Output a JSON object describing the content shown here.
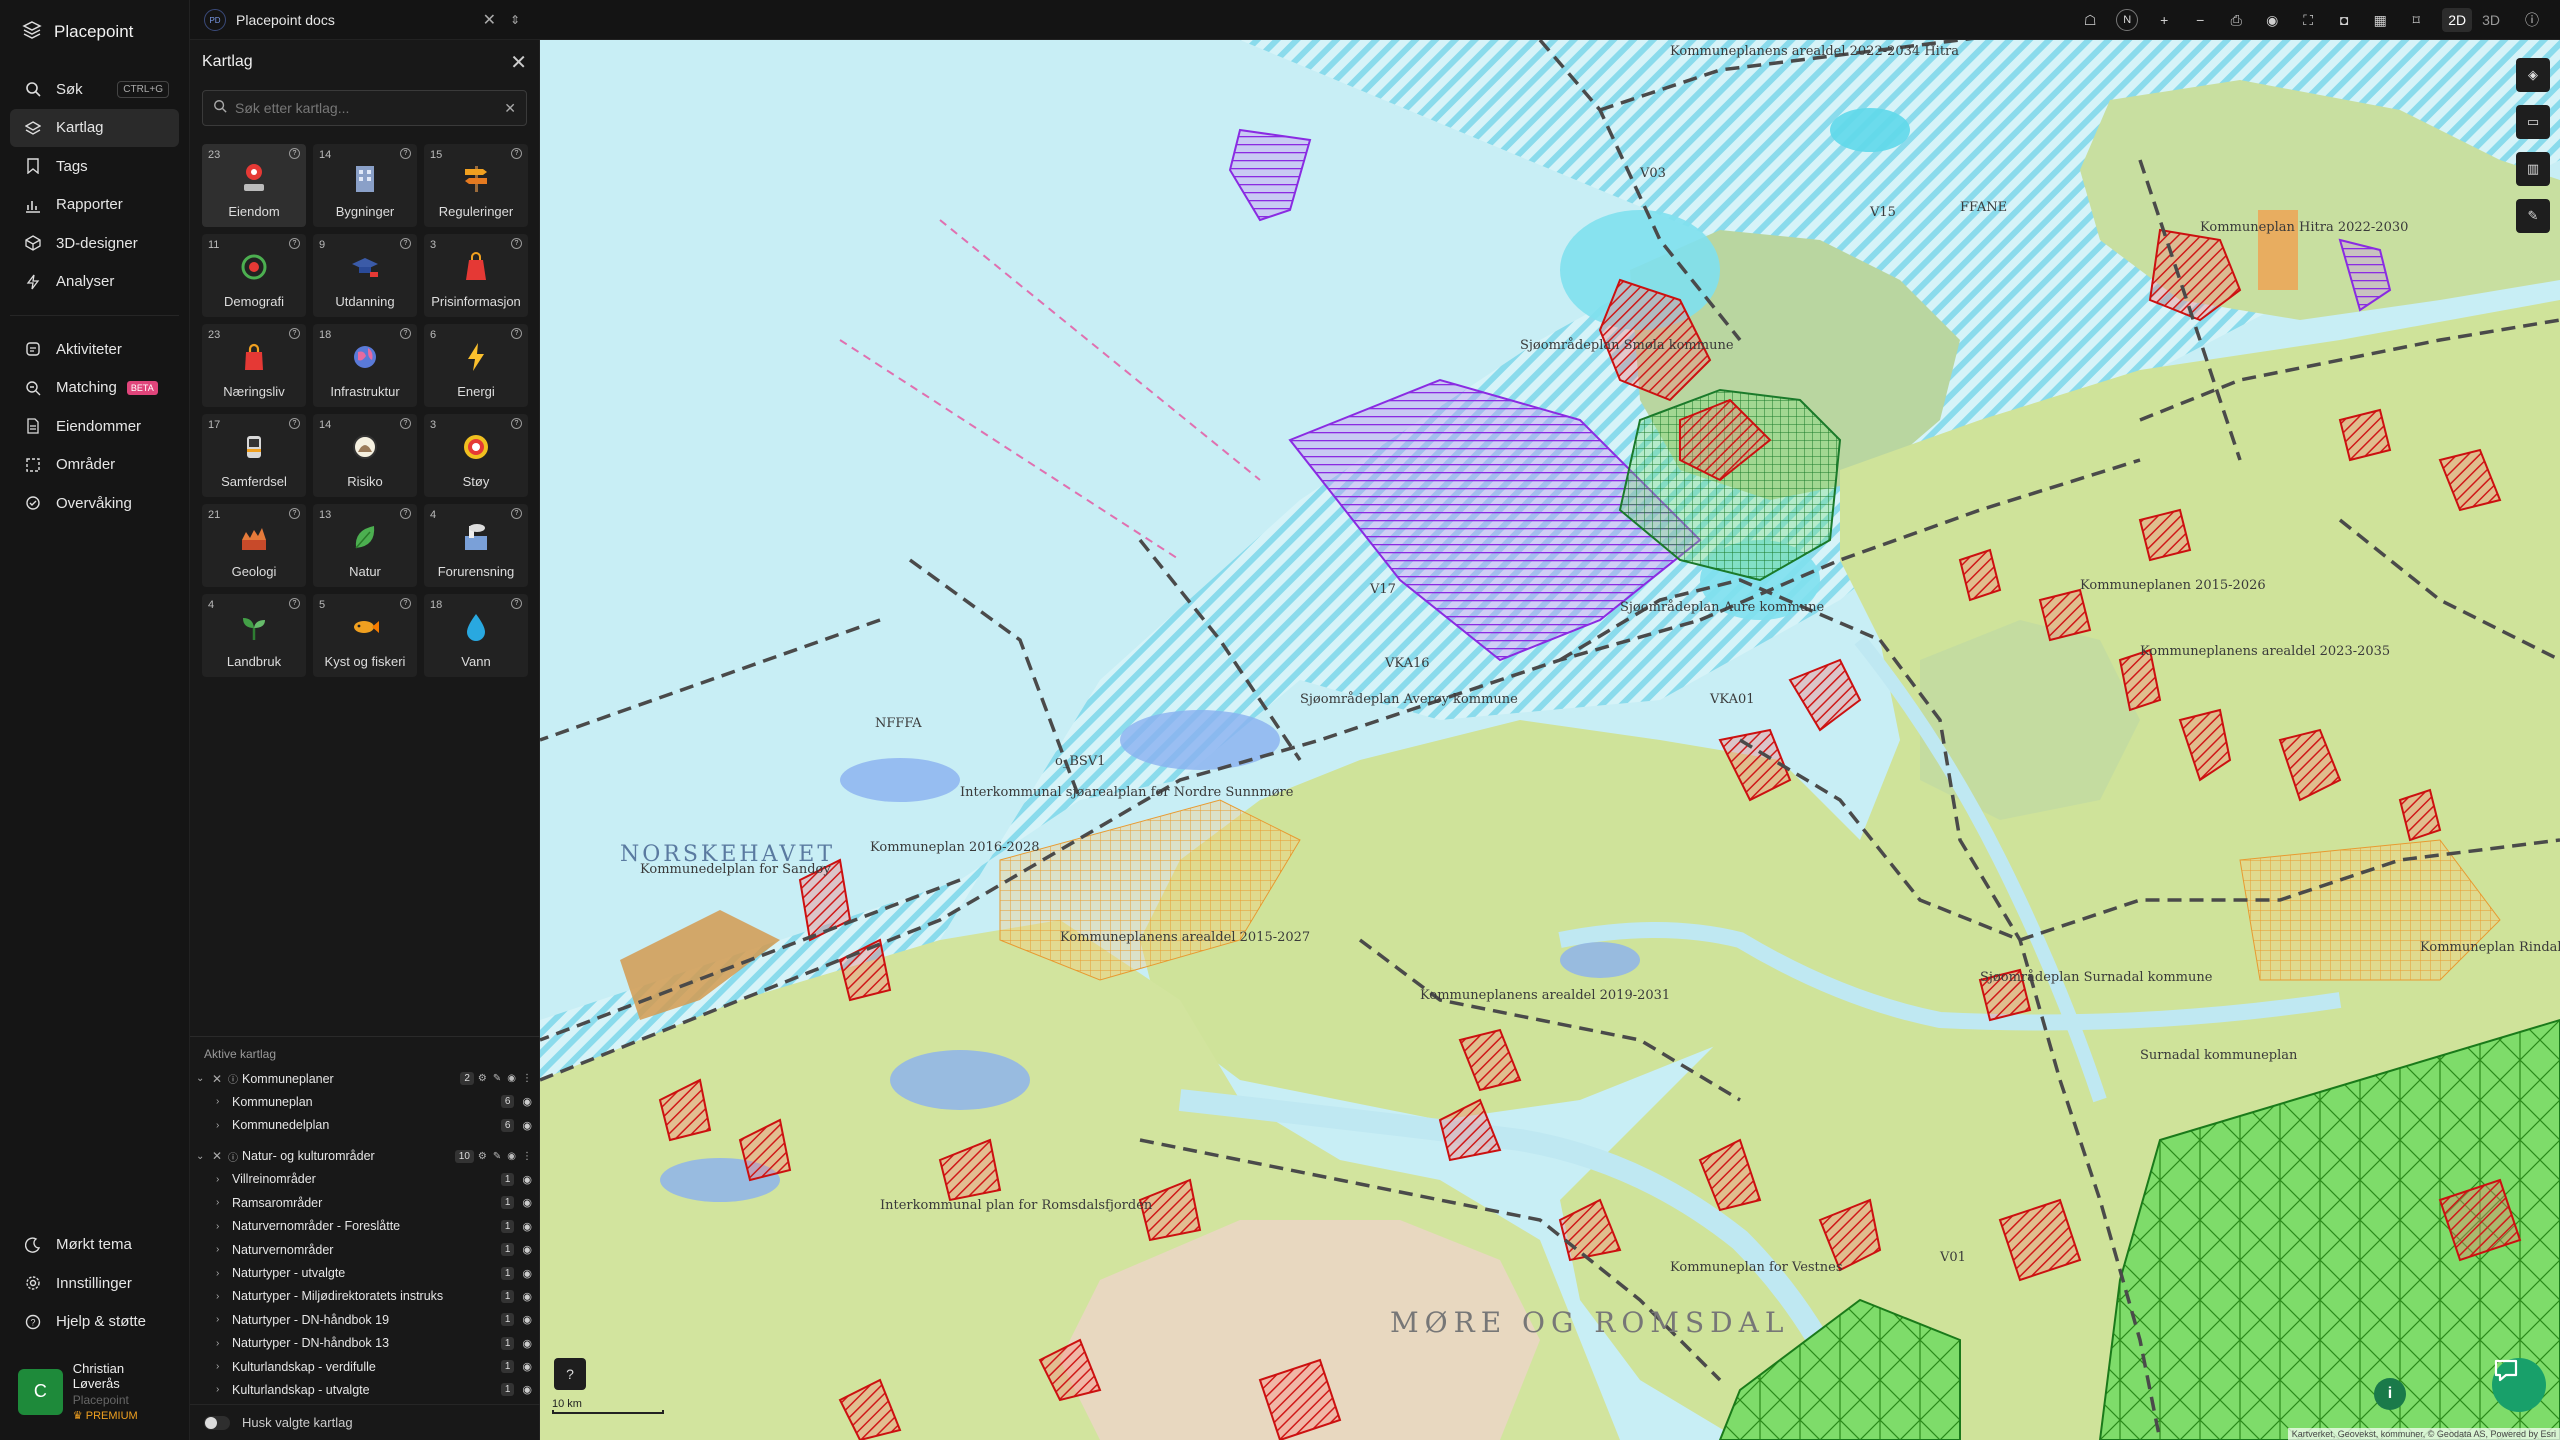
{
  "app": {
    "name": "Placepoint"
  },
  "nav": {
    "items": [
      {
        "label": "Søk",
        "icon": "search-icon",
        "shortcut": "CTRL+G"
      },
      {
        "label": "Kartlag",
        "icon": "layers-icon",
        "active": true
      },
      {
        "label": "Tags",
        "icon": "bookmark-icon"
      },
      {
        "label": "Rapporter",
        "icon": "bar-chart-icon"
      },
      {
        "label": "3D-designer",
        "icon": "cube-icon"
      },
      {
        "label": "Analyser",
        "icon": "lightning-icon"
      }
    ],
    "items2": [
      {
        "label": "Aktiviteter",
        "icon": "activity-icon"
      },
      {
        "label": "Matching",
        "icon": "match-icon",
        "badge": "BETA"
      },
      {
        "label": "Eiendommer",
        "icon": "document-icon"
      },
      {
        "label": "Områder",
        "icon": "area-icon"
      },
      {
        "label": "Overvåking",
        "icon": "monitor-icon"
      }
    ],
    "bottom": [
      {
        "label": "Mørkt tema",
        "icon": "moon-icon"
      },
      {
        "label": "Innstillinger",
        "icon": "gear-icon"
      },
      {
        "label": "Hjelp & støtte",
        "icon": "help-icon"
      }
    ]
  },
  "user": {
    "initial": "C",
    "name": "Christian Løverås",
    "org": "Placepoint",
    "tier": "PREMIUM"
  },
  "topbar": {
    "badge": "PD",
    "doc_title": "Placepoint docs",
    "view_2d": "2D",
    "view_3d": "3D",
    "compass": "N"
  },
  "panel": {
    "title": "Kartlag",
    "search_placeholder": "Søk etter kartlag...",
    "categories": [
      {
        "count": "23",
        "label": "Eiendom",
        "icon": "property-pin-icon",
        "active": true
      },
      {
        "count": "14",
        "label": "Bygninger",
        "icon": "building-icon"
      },
      {
        "count": "15",
        "label": "Reguleringer",
        "icon": "signpost-icon"
      },
      {
        "count": "11",
        "label": "Demografi",
        "icon": "demography-icon"
      },
      {
        "count": "9",
        "label": "Utdanning",
        "icon": "graduation-icon"
      },
      {
        "count": "3",
        "label": "Prisinformasjon",
        "icon": "price-tag-icon"
      },
      {
        "count": "23",
        "label": "Næringsliv",
        "icon": "shopping-bag-icon"
      },
      {
        "count": "18",
        "label": "Infrastruktur",
        "icon": "globe-icon"
      },
      {
        "count": "6",
        "label": "Energi",
        "icon": "lightning-icon"
      },
      {
        "count": "17",
        "label": "Samferdsel",
        "icon": "bus-icon"
      },
      {
        "count": "14",
        "label": "Risiko",
        "icon": "risk-icon"
      },
      {
        "count": "3",
        "label": "Støy",
        "icon": "noise-icon"
      },
      {
        "count": "21",
        "label": "Geologi",
        "icon": "geology-icon"
      },
      {
        "count": "13",
        "label": "Natur",
        "icon": "leaf-icon"
      },
      {
        "count": "4",
        "label": "Forurensning",
        "icon": "factory-icon"
      },
      {
        "count": "4",
        "label": "Landbruk",
        "icon": "sprout-icon"
      },
      {
        "count": "5",
        "label": "Kyst og fiskeri",
        "icon": "fish-icon"
      },
      {
        "count": "18",
        "label": "Vann",
        "icon": "water-drop-icon"
      }
    ],
    "active_title": "Aktive kartlag",
    "groups": [
      {
        "name": "Kommuneplaner",
        "count": "2",
        "rows": [
          {
            "name": "Kommuneplan",
            "count": "6"
          },
          {
            "name": "Kommunedelplan",
            "count": "6"
          }
        ]
      },
      {
        "name": "Natur- og kulturområder",
        "count": "10",
        "rows": [
          {
            "name": "Villreinområder",
            "count": "1"
          },
          {
            "name": "Ramsarområder",
            "count": "1"
          },
          {
            "name": "Naturvernområder - Foreslåtte",
            "count": "1"
          },
          {
            "name": "Naturvernområder",
            "count": "1"
          },
          {
            "name": "Naturtyper - utvalgte",
            "count": "1"
          },
          {
            "name": "Naturtyper - Miljødirektoratets instruks",
            "count": "1"
          },
          {
            "name": "Naturtyper - DN-håndbok 19",
            "count": "1"
          },
          {
            "name": "Naturtyper - DN-håndbok 13",
            "count": "1"
          },
          {
            "name": "Kulturlandskap - verdifulle",
            "count": "1"
          },
          {
            "name": "Kulturlandskap - utvalgte",
            "count": "1"
          }
        ]
      }
    ],
    "remember_label": "Husk valgte kartlag"
  },
  "map": {
    "labels": {
      "sea": "NORSKEHAVET",
      "region": "MØRE OG ROMSDAL",
      "l1": "Kommuneplanens arealdel 2022-2034 Hitra",
      "l2": "Sjøområdeplan Smøla kommune",
      "l3": "Sjøområdeplan Aure kommune",
      "l4": "Sjøområdeplan Averøy kommune",
      "l5": "Interkommunal sjøarealplan for Nordre Sunnmøre",
      "l6": "Kommuneplan 2016-2028",
      "l7": "Kommunedelplan for Sandøy",
      "l8": "Kommuneplanens arealdel 2019-2031",
      "l9": "Kommuneplanens arealdel 2015-2027",
      "l10": "Kommuneplanens arealdel 2023-2035",
      "l11": "Surnadal kommuneplan",
      "l12": "Sjøområdeplan Surnadal kommune",
      "l13": "Interkommunal plan for Romsdalsfjorden",
      "l14": "Kommuneplan for Vestnes",
      "l15": "Kommuneplan Hitra 2022-2030",
      "l16": "Kommuneplanen 2015-2026",
      "l17": "Kommuneplan Rindal",
      "c1": "V17",
      "c2": "V15",
      "c3": "VKA16",
      "c4": "NFFFA",
      "c5": "o_BSV1",
      "c6": "FFANE",
      "c7": "V03",
      "c8": "VKA01",
      "c9": "V01"
    },
    "scale": "10 km",
    "attribution": "Kartverket, Geovekst, kommuner, © Geodata AS, Powered by Esri"
  }
}
